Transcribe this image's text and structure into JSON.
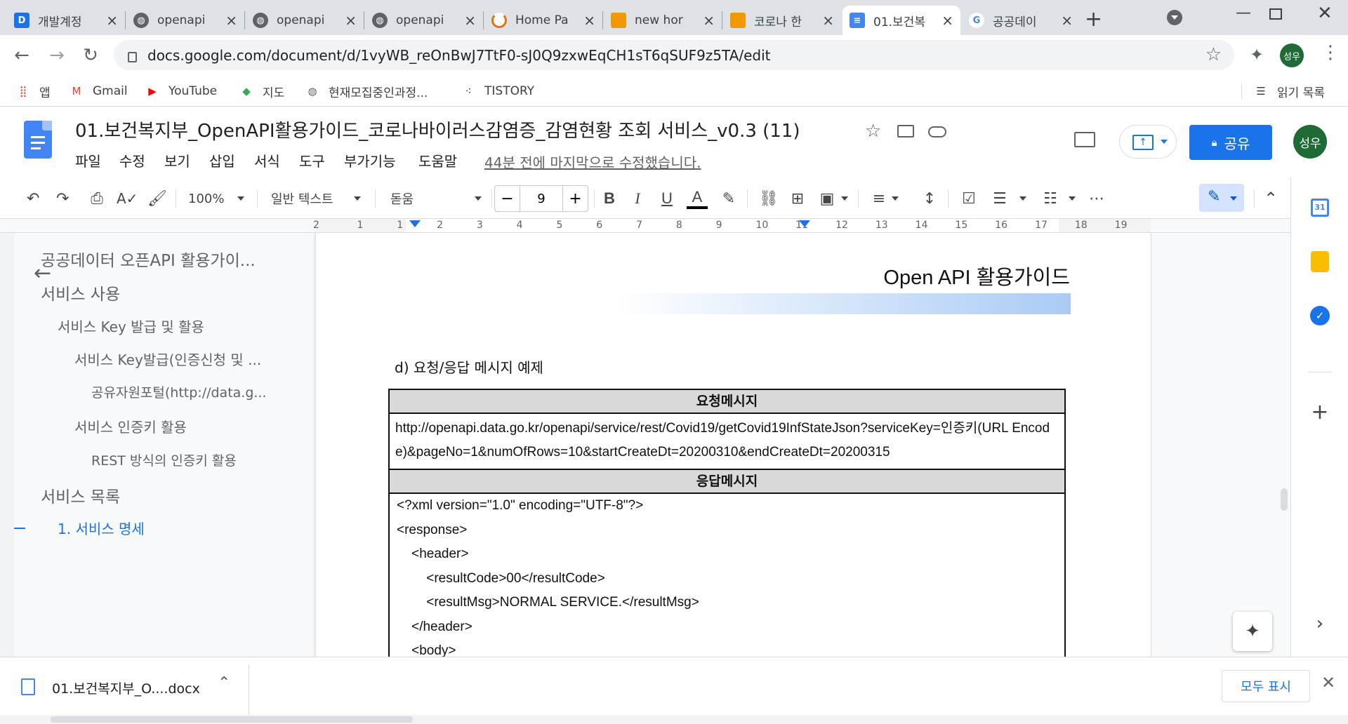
{
  "tabs": [
    {
      "title": "개발계정",
      "icon": "d-app-icon",
      "favcolor": "#1a73e8"
    },
    {
      "title": "openapi",
      "icon": "globe-icon",
      "favcolor": "#5f6368"
    },
    {
      "title": "openapi",
      "icon": "globe-icon",
      "favcolor": "#5f6368"
    },
    {
      "title": "openapi",
      "icon": "globe-icon",
      "favcolor": "#5f6368"
    },
    {
      "title": "Home Pa",
      "icon": "loading-icon",
      "favcolor": "#e8710a"
    },
    {
      "title": "new hor",
      "icon": "book-icon",
      "favcolor": "#f29900"
    },
    {
      "title": "코로나 한",
      "icon": "book-icon",
      "favcolor": "#f29900"
    },
    {
      "title": "01.보건복",
      "icon": "docs-icon",
      "favcolor": "#4285f4"
    },
    {
      "title": "공공데이",
      "icon": "google-icon",
      "favcolor": "#4285f4"
    }
  ],
  "omnibox": {
    "url": "docs.google.com/document/d/1vyWB_reOnBwJ7TtF0-sJ0Q9zxwEqCH1sT6qSUF9z5TA/edit"
  },
  "profile": {
    "initials": "성우",
    "color": "#1e6b35"
  },
  "bookmarks": [
    {
      "label": "앱",
      "icon": "apps-grid-icon"
    },
    {
      "label": "Gmail",
      "icon": "gmail-icon"
    },
    {
      "label": "YouTube",
      "icon": "youtube-icon"
    },
    {
      "label": "지도",
      "icon": "maps-icon"
    },
    {
      "label": "현재모집중인과정...",
      "icon": "globe-icon"
    },
    {
      "label": "TISTORY",
      "icon": "tistory-icon"
    }
  ],
  "reading_list": "읽기 목록",
  "doc": {
    "title": "01.보건복지부_OpenAPI활용가이드_코로나바이러스감염증_감염현황 조회 서비스_v0.3 (11)",
    "menus": [
      "파일",
      "수정",
      "보기",
      "삽입",
      "서식",
      "도구",
      "부가기능",
      "도움말"
    ],
    "last_edit": "44분 전에 마지막으로 수정했습니다.",
    "share_label": "공유"
  },
  "toolbar": {
    "zoom": "100%",
    "style": "일반 텍스트",
    "font": "돋움",
    "font_size": "9",
    "minus": "−",
    "plus": "+"
  },
  "ruler": [
    "2",
    "1",
    "1",
    "2",
    "3",
    "4",
    "5",
    "6",
    "7",
    "8",
    "9",
    "10",
    "11",
    "12",
    "13",
    "14",
    "15",
    "16",
    "17",
    "18",
    "19"
  ],
  "outline": [
    {
      "text": "공공데이터 오픈API 활용가이...",
      "level": 0
    },
    {
      "text": "서비스 사용",
      "level": 0
    },
    {
      "text": "서비스 Key 발급 및 활용",
      "level": 1
    },
    {
      "text": "서비스 Key발급(인증신청 및 ...",
      "level": 2
    },
    {
      "text": "공유자원포털(http://data.g...",
      "level": 3
    },
    {
      "text": "서비스 인증키 활용",
      "level": 2
    },
    {
      "text": "REST 방식의 인증키 활용",
      "level": 3
    },
    {
      "text": "서비스 목록",
      "level": 0
    },
    {
      "text": "1. 서비스 명세",
      "level": 1,
      "active": true
    }
  ],
  "page": {
    "header": "Open API 활용가이드",
    "section_title": "d) 요청/응답 메시지 예제",
    "request_header": "요청메시지",
    "request_body": "http://openapi.data.go.kr/openapi/service/rest/Covid19/getCovid19InfStateJson?serviceKey=인증키(URL Encode)&pageNo=1&numOfRows=10&startCreateDt=20200310&endCreateDt=20200315",
    "response_header": "응답메시지",
    "response_lines": [
      "<?xml version=\"1.0\" encoding=\"UTF-8\"?>",
      "<response>",
      "    <header>",
      "        <resultCode>00</resultCode>",
      "        <resultMsg>NORMAL SERVICE.</resultMsg>",
      "    </header>",
      "    <body>"
    ]
  },
  "download": {
    "filename": "01.보건복지부_O....docx",
    "show_all": "모두 표시"
  }
}
